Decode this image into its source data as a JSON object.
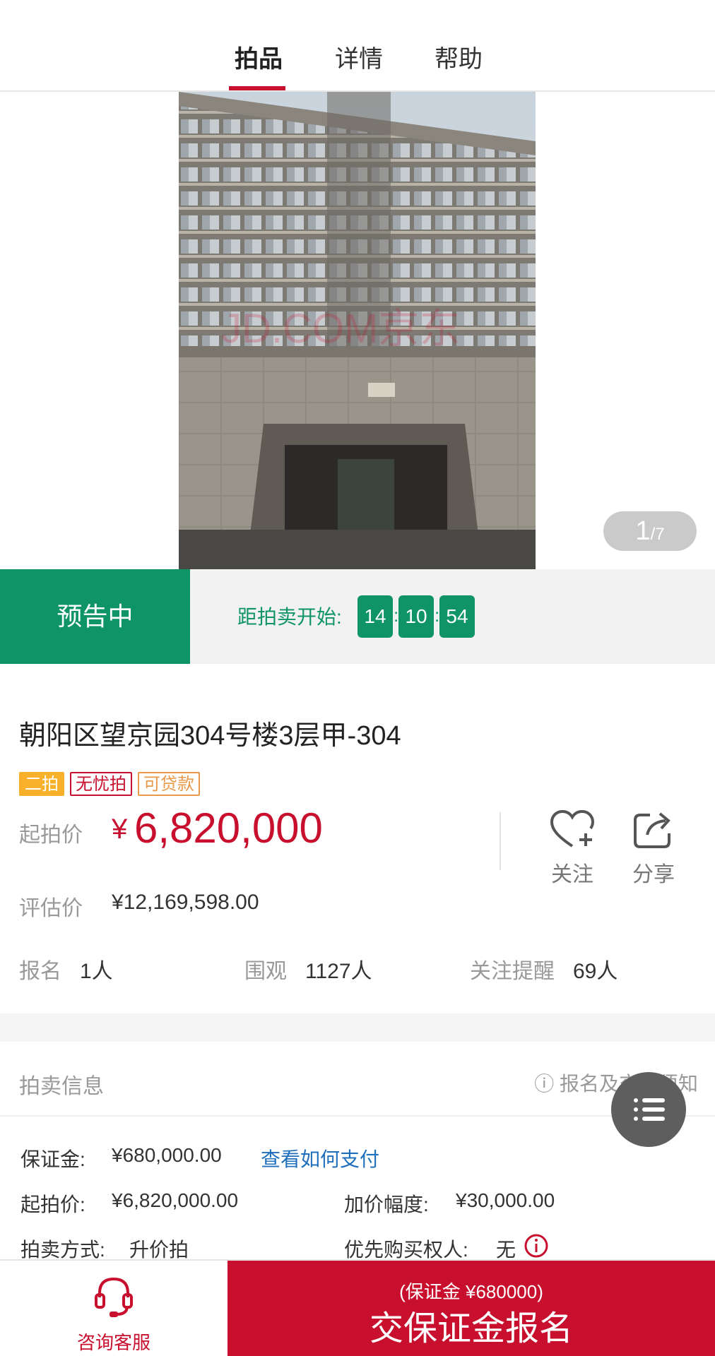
{
  "tabs": [
    {
      "label": "拍品",
      "active": true
    },
    {
      "label": "详情",
      "active": false
    },
    {
      "label": "帮助",
      "active": false
    }
  ],
  "gallery": {
    "current": "1",
    "total": "/7",
    "watermark": "JD.COM京东"
  },
  "status": {
    "label": "预告中",
    "countdown_label": "距拍卖开始:",
    "hours": "14",
    "minutes": "10",
    "seconds": "54",
    "sep": ":"
  },
  "item": {
    "title": "朝阳区望京园304号楼3层甲-304",
    "tags": [
      "二拍",
      "无忧拍",
      "可贷款"
    ],
    "start_price_label": "起拍价",
    "currency": "¥",
    "start_price": "6,820,000",
    "eval_label": "评估价",
    "eval_value": "¥12,169,598.00",
    "follow_label": "关注",
    "share_label": "分享"
  },
  "stats": [
    {
      "key": "报名",
      "value": "1人"
    },
    {
      "key": "围观",
      "value": "1127人"
    },
    {
      "key": "关注提醒",
      "value": "69人"
    }
  ],
  "auction_info": {
    "title": "拍卖信息",
    "notice": "ⓘ 报名及交保须知",
    "deposit_label": "保证金:",
    "deposit_value": "¥680,000.00",
    "deposit_link": "查看如何支付",
    "start_label": "起拍价:",
    "start_value": "¥6,820,000.00",
    "increment_label": "加价幅度:",
    "increment_value": "¥30,000.00",
    "method_label": "拍卖方式:",
    "method_value": "升价拍",
    "priority_label": "优先购买权人:",
    "priority_value": "无"
  },
  "bottom_bar": {
    "consult_label": "咨询客服",
    "cta_sub": "(保证金 ¥680000)",
    "cta_main": "交保证金报名"
  },
  "colors": {
    "brand_red": "#c8102e",
    "green": "#0f9468",
    "link_blue": "#1f6fbd"
  }
}
